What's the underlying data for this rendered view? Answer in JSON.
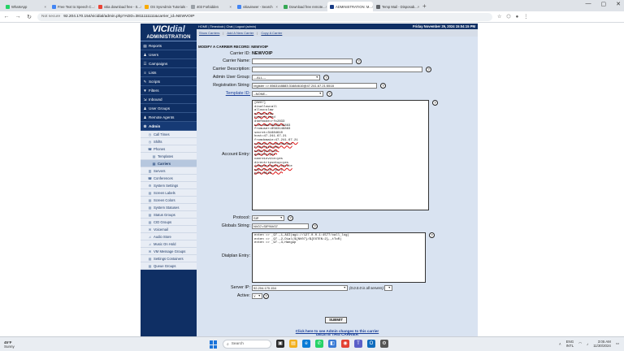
{
  "browser": {
    "tabs": [
      {
        "label": "WhatsApp",
        "color": "#25d366",
        "active": false
      },
      {
        "label": "Free Text to Speech C...",
        "color": "#4285f4",
        "active": false
      },
      {
        "label": "vitia download free - S...",
        "color": "#ea4335",
        "active": false
      },
      {
        "label": "OS SysAdmin Tutorials -...",
        "color": "#f9ab00",
        "active": false
      },
      {
        "label": "403 Forbidden",
        "color": "#9aa0a6",
        "active": false
      },
      {
        "label": "vitiaviewer - Search",
        "color": "#4285f4",
        "active": false
      },
      {
        "label": "Download free remote...",
        "color": "#34a853",
        "active": false
      },
      {
        "label": "ADMINISTRATION: M...",
        "color": "#1a3d85",
        "active": true
      },
      {
        "label": "Temp Mail - Disposab...",
        "color": "#5f6368",
        "active": false
      }
    ],
    "new_tab": "+",
    "not_secure": "Not secure",
    "url": "92.204.170.154/vicidial/admin.php?ADD=3811111111&carrier_id=NEWVOIP",
    "window_controls": [
      "—",
      "▢",
      "✕"
    ]
  },
  "top_strip": {
    "links": "HOME | Timeclock | Chat | Logout (admin)",
    "date": "Friday November 29, 2024 15:04:15 PM"
  },
  "subnav": {
    "show_carriers": "Show Carriers",
    "add_carrier": "Add A New Carrier",
    "copy_carrier": "Copy A Carrier",
    "sep": "|"
  },
  "sidebar": {
    "logo_a": "VICI",
    "logo_b": "dial",
    "title": "ADMINISTRATION",
    "items": [
      {
        "label": "Reports",
        "icon": "▤"
      },
      {
        "label": "Users",
        "icon": "♟"
      },
      {
        "label": "Campaigns",
        "icon": "☰"
      },
      {
        "label": "Lists",
        "icon": "≡"
      },
      {
        "label": "Scripts",
        "icon": "✎"
      },
      {
        "label": "Filters",
        "icon": "▼"
      },
      {
        "label": "Inbound",
        "icon": "⇲"
      },
      {
        "label": "User Groups",
        "icon": "♟"
      },
      {
        "label": "Remote Agents",
        "icon": "♟"
      },
      {
        "label": "Admin",
        "icon": "⚙"
      }
    ],
    "admin_sub": [
      {
        "label": "Call Times",
        "icon": "◷"
      },
      {
        "label": "Shifts",
        "icon": "◷"
      },
      {
        "label": "Phones",
        "icon": "☎"
      },
      {
        "label": "Templates",
        "icon": "▤"
      },
      {
        "label": "Carriers",
        "icon": "▤"
      },
      {
        "label": "Servers",
        "icon": "▥"
      },
      {
        "label": "Conferences",
        "icon": "☎"
      },
      {
        "label": "System Settings",
        "icon": "⚙"
      },
      {
        "label": "Screen Labels",
        "icon": "▤"
      },
      {
        "label": "Screen Colors",
        "icon": "▤"
      },
      {
        "label": "System Statuses",
        "icon": "▤"
      },
      {
        "label": "Status Groups",
        "icon": "▤"
      },
      {
        "label": "CID Groups",
        "icon": "▤"
      },
      {
        "label": "Voicemail",
        "icon": "✉"
      },
      {
        "label": "Audio Store",
        "icon": "♫"
      },
      {
        "label": "Music On Hold",
        "icon": "♫"
      },
      {
        "label": "VM Message Groups",
        "icon": "✉"
      },
      {
        "label": "Settings Containers",
        "icon": "▤"
      },
      {
        "label": "Queue Groups",
        "icon": "▤"
      }
    ]
  },
  "form": {
    "section_title": "MODIFY A CARRIER RECORD: NEWVOIP",
    "carrier_id_label": "Carrier ID:",
    "carrier_id_value": "NEWVOIP",
    "carrier_name_label": "Carrier Name:",
    "carrier_name_value": "",
    "carrier_desc_label": "Carrier Description:",
    "carrier_desc_value": "",
    "admin_group_label": "Admin User Group:",
    "admin_group_value": "---ALL---",
    "reg_label": "Registration String:",
    "reg_value": "register => 8563148883:31684610@47.241.67.21:5518",
    "template_label": "Template ID:",
    "template_value": "--NONE--",
    "account_label": "Account Entry:",
    "account_lines": [
      "[NV07]",
      "disallow=all",
      "allow=ulaw",
      "allow=alaw",
      "type=friend",
      "dtmfmode=rfc2833",
      "username=8563148883",
      "fromuser=8563148883",
      "secret=31684610",
      "host=47.241.67.21",
      "fromdomain=47.241.67.21",
      "context=trunkinbound",
      "trustrpid=yes",
      "sendrpid=yes",
      "qualify=yes",
      "canreinvite=yes",
      "directrtpsetup=yes",
      "insecure=port,invite",
      "nat=force_rport",
      "port=5518"
    ],
    "protocol_label": "Protocol:",
    "protocol_value": "SIP",
    "globals_label": "Globals String:",
    "globals_value": "NV07=SIP/NV07",
    "dialplan_label": "Dialplan Entry:",
    "dialplan_lines": [
      "exten => _97.,1,AGI(agi://127.0.0.1:4577/call_log)",
      "exten => _97.,2,Dial(${NV07}/${EXTEN:2},,tToR)",
      "exten => _97.,3,Hangup"
    ],
    "server_label": "Server IP:",
    "server_value": "92.204.170.154",
    "server_note": "(0.0.0.0 is all servers)",
    "active_label": "Active:",
    "active_value": "Y",
    "submit": "SUBMIT",
    "delete_link": "DELETE THIS CARRIER",
    "admin_log_link": "Click here to see Admin changes to this carrier"
  },
  "taskbar": {
    "weather_temp": "45°F",
    "weather_desc": "Sunny",
    "search": "Search",
    "lang": "ENG",
    "region": "INTL",
    "time": "3:05 AM",
    "date": "11/30/2024"
  }
}
